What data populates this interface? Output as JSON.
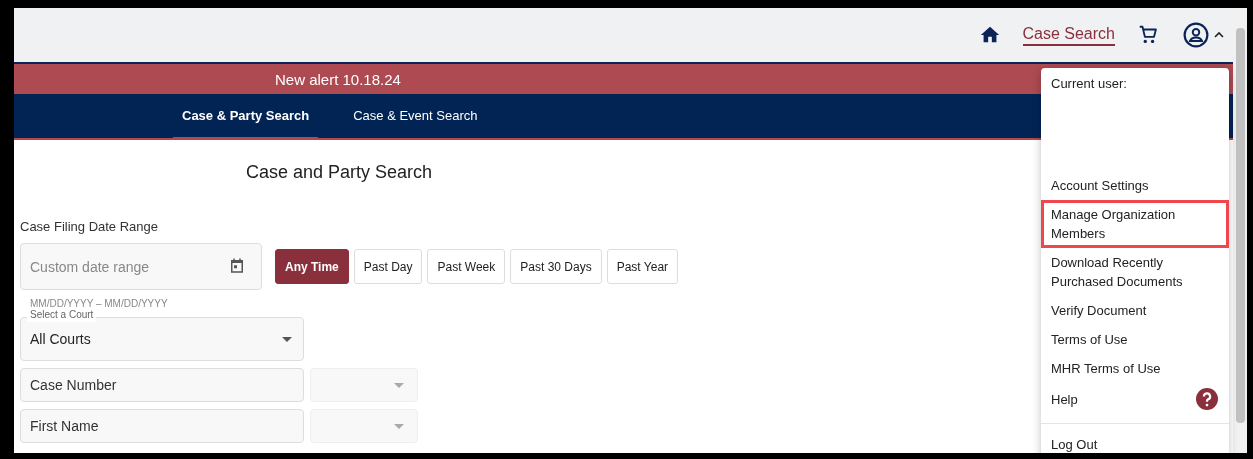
{
  "header": {
    "nav_link": "Case Search",
    "account_expanded": true
  },
  "alert": {
    "text": "New alert 10.18.24"
  },
  "tabs": [
    {
      "label": "Case & Party Search",
      "selected": true
    },
    {
      "label": "Case & Event Search",
      "selected": false
    }
  ],
  "page_title": "Case and Party Search",
  "date_range": {
    "label": "Case Filing Date Range",
    "placeholder": "Custom date range",
    "hint": "MM/DD/YYYY – MM/DD/YYYY",
    "presets": [
      {
        "label": "Any Time",
        "selected": true
      },
      {
        "label": "Past Day",
        "selected": false
      },
      {
        "label": "Past Week",
        "selected": false
      },
      {
        "label": "Past 30 Days",
        "selected": false
      },
      {
        "label": "Past Year",
        "selected": false
      }
    ]
  },
  "court_select": {
    "label": "Select a Court",
    "value": "All Courts"
  },
  "fields": [
    {
      "placeholder": "Case Number"
    },
    {
      "placeholder": "First Name"
    }
  ],
  "user_menu": {
    "heading": "Current user:",
    "items": [
      {
        "label": "Account Settings",
        "kind": "link",
        "highlighted": false
      },
      {
        "label": "Manage Organization Members",
        "kind": "link",
        "highlighted": true
      },
      {
        "label": "Download Recently Purchased Documents",
        "kind": "link",
        "highlighted": false
      },
      {
        "label": "Verify Document",
        "kind": "link",
        "highlighted": false
      },
      {
        "label": "Terms of Use",
        "kind": "link",
        "highlighted": false
      },
      {
        "label": "MHR Terms of Use",
        "kind": "link",
        "highlighted": false
      },
      {
        "label": "Help",
        "kind": "help",
        "highlighted": false
      }
    ],
    "footer_items": [
      {
        "label": "Log Out"
      }
    ]
  }
}
